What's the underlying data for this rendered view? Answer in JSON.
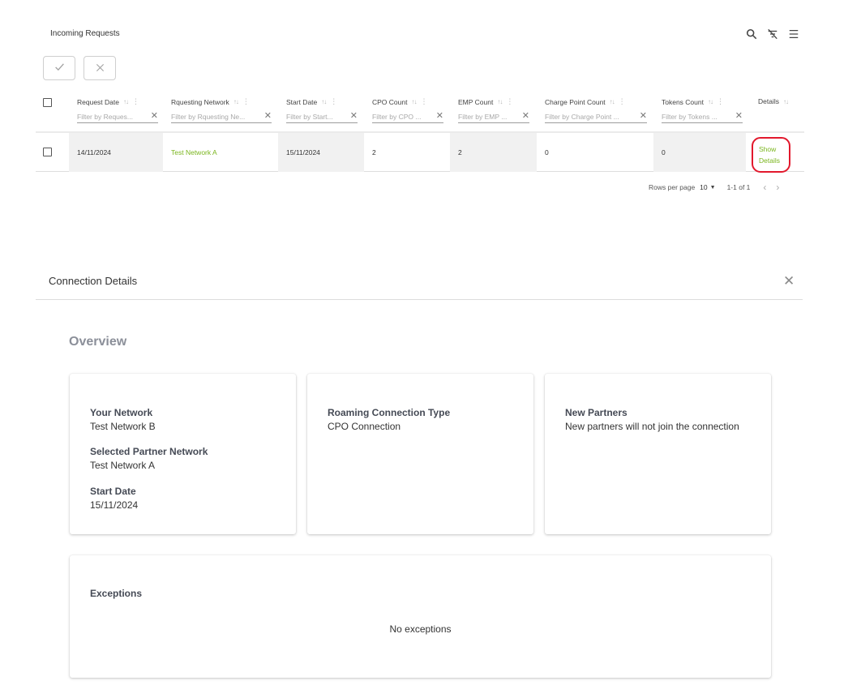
{
  "requests": {
    "title": "Incoming Requests",
    "toolbar_icons": [
      "search-icon",
      "filter-off-icon",
      "menu-icon"
    ],
    "approve_icon": "check-icon",
    "reject_icon": "close-icon",
    "columns": [
      {
        "label": "Request Date",
        "filter_placeholder": "Filter by Reques..."
      },
      {
        "label": "Rquesting Network",
        "filter_placeholder": "Filter by Rquesting Ne..."
      },
      {
        "label": "Start Date",
        "filter_placeholder": "Filter by Start..."
      },
      {
        "label": "CPO Count",
        "filter_placeholder": "Filter by CPO ..."
      },
      {
        "label": "EMP Count",
        "filter_placeholder": "Filter by EMP ..."
      },
      {
        "label": "Charge Point Count",
        "filter_placeholder": "Filter by Charge Point ..."
      },
      {
        "label": "Tokens Count",
        "filter_placeholder": "Filter by Tokens ..."
      },
      {
        "label": "Details"
      }
    ],
    "rows": [
      {
        "request_date": "14/11/2024",
        "requesting_network": "Test Network A",
        "start_date": "15/11/2024",
        "cpo_count": "2",
        "emp_count": "2",
        "charge_point_count": "0",
        "tokens_count": "0",
        "details_line1": "Show",
        "details_line2": "Details"
      }
    ],
    "pagination": {
      "rows_per_page_label": "Rows per page",
      "rows_per_page_value": "10",
      "range": "1-1 of 1"
    },
    "accent_color": "#7ab51d",
    "highlight_color": "#e2192d"
  },
  "details": {
    "title": "Connection Details",
    "overview_heading": "Overview",
    "your_network_label": "Your Network",
    "your_network_value": "Test Network B",
    "partner_label": "Selected Partner Network",
    "partner_value": "Test Network A",
    "start_label": "Start Date",
    "start_value": "15/11/2024",
    "type_label": "Roaming Connection Type",
    "type_value": "CPO Connection",
    "new_partners_label": "New Partners",
    "new_partners_value": "New partners will not join the connection",
    "exceptions_label": "Exceptions",
    "exceptions_value": "No exceptions"
  }
}
